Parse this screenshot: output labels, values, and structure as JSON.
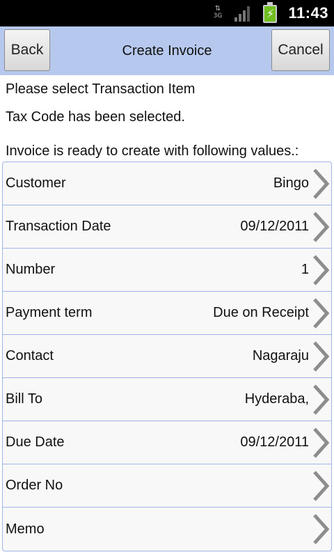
{
  "status_bar": {
    "network": "3G",
    "time": "11:43"
  },
  "header": {
    "back_label": "Back",
    "title": "Create Invoice",
    "cancel_label": "Cancel"
  },
  "messages": [
    "Please select Transaction Item",
    "Tax Code has been selected.",
    "Invoice is ready to create with following values.:"
  ],
  "fields": [
    {
      "label": "Customer",
      "value": "Bingo"
    },
    {
      "label": "Transaction Date",
      "value": "09/12/2011"
    },
    {
      "label": "Number",
      "value": "1"
    },
    {
      "label": "Payment term",
      "value": "Due on Receipt"
    },
    {
      "label": "Contact",
      "value": "Nagaraju"
    },
    {
      "label": "Bill To",
      "value": "Hyderaba,"
    },
    {
      "label": "Due Date",
      "value": "09/12/2011"
    },
    {
      "label": "Order No",
      "value": ""
    },
    {
      "label": "Memo",
      "value": ""
    }
  ],
  "colors": {
    "titlebar": "#b6c8ee",
    "row_border": "#9fb3e6",
    "battery": "#6fbf1f"
  },
  "icons": {
    "network": "3g-data-icon",
    "signal": "signal-strength-icon",
    "battery": "battery-charging-icon",
    "row_action": "chevron-right-icon"
  }
}
